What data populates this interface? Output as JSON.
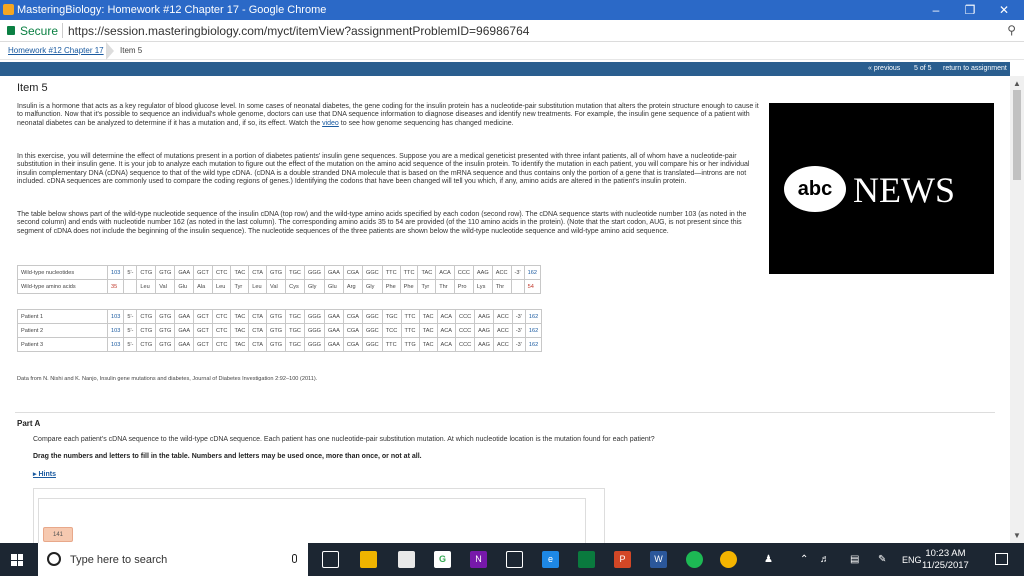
{
  "window": {
    "title": "MasteringBiology: Homework #12 Chapter 17 - Google Chrome"
  },
  "address": {
    "secure": "Secure",
    "url": "https://session.masteringbiology.com/myct/itemView?assignmentProblemID=96986764"
  },
  "breadcrumb": {
    "link": "Homework #12 Chapter 17",
    "current": "Item 5"
  },
  "nav": {
    "previous": "« previous",
    "position": "5 of 5",
    "return": "return to assignment"
  },
  "item": {
    "title": "Item 5",
    "p1": "Insulin is a hormone that acts as a key regulator of blood glucose level. In some cases of neonatal diabetes, the gene coding for the insulin protein has a nucleotide-pair substitution mutation that alters the protein structure enough to cause it to malfunction. Now that it's possible to sequence an individual's whole genome, doctors can use that DNA sequence information to diagnose diseases and identify new treatments. For example, the insulin gene sequence of a patient with neonatal diabetes can be analyzed to determine if it has a mutation and, if so, its effect. Watch the",
    "p1_link": "video",
    "p1_end": "to see how genome sequencing has changed medicine.",
    "p2": "In this exercise, you will determine the effect of mutations present in a portion of diabetes patients' insulin gene sequences. Suppose you are a medical geneticist presented with three infant patients, all of whom have a nucleotide-pair substitution in their insulin gene. It is your job to analyze each mutation to figure out the effect of the mutation on the amino acid sequence of the insulin protein. To identify the mutation in each patient, you will compare his or her individual insulin complementary DNA (cDNA) sequence to that of the wild type cDNA. (cDNA is a double stranded DNA molecule that is based on the mRNA sequence and thus contains only the portion of a gene that is translated—introns are not included. cDNA sequences are commonly used to compare the coding regions of genes.) Identifying the codons that have been changed will tell you which, if any, amino acids are altered in the patient's insulin protein.",
    "p3": "The table below shows part of the wild-type nucleotide sequence of the insulin cDNA (top row) and the wild-type amino acids specified by each codon (second row). The cDNA sequence starts with nucleotide number 103 (as noted in the second column) and ends with nucleotide number 162 (as noted in the last column). The corresponding amino acids 35 to 54 are provided (of the 110 amino acids in the protein). (Note that the start codon, AUG, is not present since this segment of cDNA does not include the beginning of the insulin sequence). The nucleotide sequences of the three patients are shown below the wild-type nucleotide sequence and wild-type amino acid sequence."
  },
  "video": {
    "logo": "abc",
    "text": "NEWS"
  },
  "table": {
    "wild": {
      "label": "Wild-type nucleotides",
      "start": "103",
      "p5": "5'-",
      "codons": [
        "CTG",
        "GTG",
        "GAA",
        "GCT",
        "CTC",
        "TAC",
        "CTA",
        "GTG",
        "TGC",
        "GGG",
        "GAA",
        "CGA",
        "GGC",
        "TTC",
        "TTC",
        "TAC",
        "ACA",
        "CCC",
        "AAG",
        "ACC"
      ],
      "p3": "-3'",
      "end": "162"
    },
    "amino": {
      "label": "Wild-type amino acids",
      "start": "35",
      "aas": [
        "Leu",
        "Val",
        "Glu",
        "Ala",
        "Leu",
        "Tyr",
        "Leu",
        "Val",
        "Cys",
        "Gly",
        "Glu",
        "Arg",
        "Gly",
        "Phe",
        "Phe",
        "Tyr",
        "Thr",
        "Pro",
        "Lys",
        "Thr"
      ],
      "end": "54"
    },
    "patients": [
      {
        "label": "Patient 1",
        "start": "103",
        "p5": "5'-",
        "codons": [
          "CTG",
          "GTG",
          "GAA",
          "GCT",
          "CTC",
          "TAC",
          "CTA",
          "GTG",
          "TGC",
          "GGG",
          "GAA",
          "CGA",
          "GGC",
          "TGC",
          "TTC",
          "TAC",
          "ACA",
          "CCC",
          "AAG",
          "ACC"
        ],
        "p3": "-3'",
        "end": "162"
      },
      {
        "label": "Patient 2",
        "start": "103",
        "p5": "5'-",
        "codons": [
          "CTG",
          "GTG",
          "GAA",
          "GCT",
          "CTC",
          "TAC",
          "CTA",
          "GTG",
          "TGC",
          "GGG",
          "GAA",
          "CGA",
          "GGC",
          "TCC",
          "TTC",
          "TAC",
          "ACA",
          "CCC",
          "AAG",
          "ACC"
        ],
        "p3": "-3'",
        "end": "162"
      },
      {
        "label": "Patient 3",
        "start": "103",
        "p5": "5'-",
        "codons": [
          "CTG",
          "GTG",
          "GAA",
          "GCT",
          "CTC",
          "TAC",
          "CTA",
          "GTG",
          "TGC",
          "GGG",
          "GAA",
          "CGA",
          "GGC",
          "TTC",
          "TTG",
          "TAC",
          "ACA",
          "CCC",
          "AAG",
          "ACC"
        ],
        "p3": "-3'",
        "end": "162"
      }
    ]
  },
  "source": "Data from N. Nishi and K. Nanjo, Insulin gene mutations and diabetes, Journal of Diabetes Investigation 2:92–100 (2011).",
  "part_a": {
    "title": "Part A",
    "question": "Compare each patient's cDNA sequence to the wild-type cDNA sequence. Each patient has one nucleotide-pair substitution mutation. At which nucleotide location is the mutation found for each patient?",
    "instruction": "Drag the numbers and letters to fill in the table. Numbers and letters may be used once, more than once, or not at all.",
    "hints": "Hints",
    "chip": "141"
  },
  "taskbar": {
    "search": "Type here to search",
    "lang": "ENG",
    "time": "10:23 AM",
    "date": "11/25/2017"
  },
  "colors": {
    "titlebar": "#2b69c7",
    "navbar": "#2a5e8f",
    "link": "#1a5aa0",
    "taskbar": "#1c2632"
  }
}
